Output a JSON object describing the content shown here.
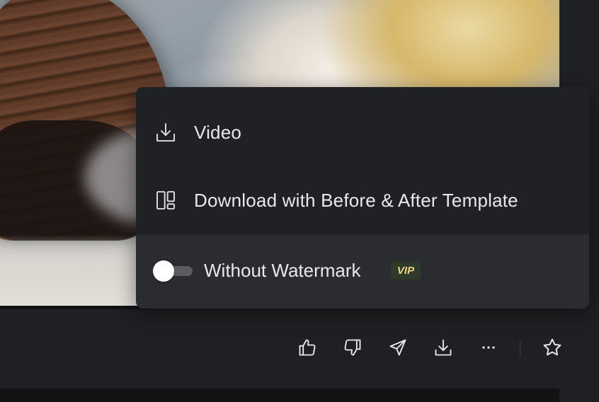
{
  "preview": {
    "description_icon": "video-frame"
  },
  "menu": {
    "items": [
      {
        "label": "Video",
        "icon": "download-icon"
      },
      {
        "label": "Download with Before & After Template",
        "icon": "layout-template-icon"
      }
    ],
    "watermark": {
      "label": "Without Watermark",
      "badge": "VIP",
      "enabled": false
    }
  },
  "toolbar": {
    "buttons": [
      {
        "icon": "thumbs-up-icon"
      },
      {
        "icon": "thumbs-down-icon"
      },
      {
        "icon": "send-icon"
      },
      {
        "icon": "download-icon"
      },
      {
        "icon": "more-icon"
      },
      {
        "icon": "star-icon"
      }
    ]
  },
  "colors": {
    "menu_bg": "#202124",
    "menu_lower_bg": "#2b2c30",
    "vip_text": "#e9d58a",
    "vip_bg": "#2f3a2a"
  }
}
